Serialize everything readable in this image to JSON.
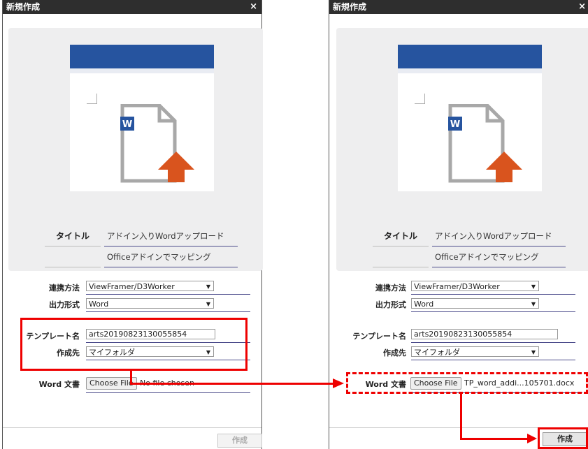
{
  "left_dialog": {
    "title": "新規作成",
    "close": "×",
    "title_label": "タイトル",
    "title_value": "アドイン入りWordアップロード",
    "description_value": "Officeアドインでマッピング",
    "link_method_label": "連携方法",
    "link_method_value": "ViewFramer/D3Worker",
    "output_format_label": "出力形式",
    "output_format_value": "Word",
    "template_name_label": "テンプレート名",
    "template_name_value": "arts20190823130055854",
    "destination_label": "作成先",
    "destination_value": "マイフォルダ",
    "word_doc_label": "Word 文書",
    "choose_file": "Choose File",
    "file_status": "No file chosen",
    "create_button": "作成"
  },
  "right_dialog": {
    "title": "新規作成",
    "close": "×",
    "title_label": "タイトル",
    "title_value": "アドイン入りWordアップロード",
    "description_value": "Officeアドインでマッピング",
    "link_method_label": "連携方法",
    "link_method_value": "ViewFramer/D3Worker",
    "output_format_label": "出力形式",
    "output_format_value": "Word",
    "template_name_label": "テンプレート名",
    "template_name_value": "arts20190823130055854",
    "destination_label": "作成先",
    "destination_value": "マイフォルダ",
    "word_doc_label": "Word 文書",
    "choose_file": "Choose File",
    "file_status": "TP_word_addi...105701.docx",
    "create_button": "作成"
  },
  "icons": {
    "doc_letter": "W",
    "dropdown_caret": "▼"
  },
  "colors": {
    "titlebar": "#2e2e2e",
    "word_blue": "#26549f",
    "upload_arrow": "#d9541e",
    "highlight_red": "#e00000"
  }
}
